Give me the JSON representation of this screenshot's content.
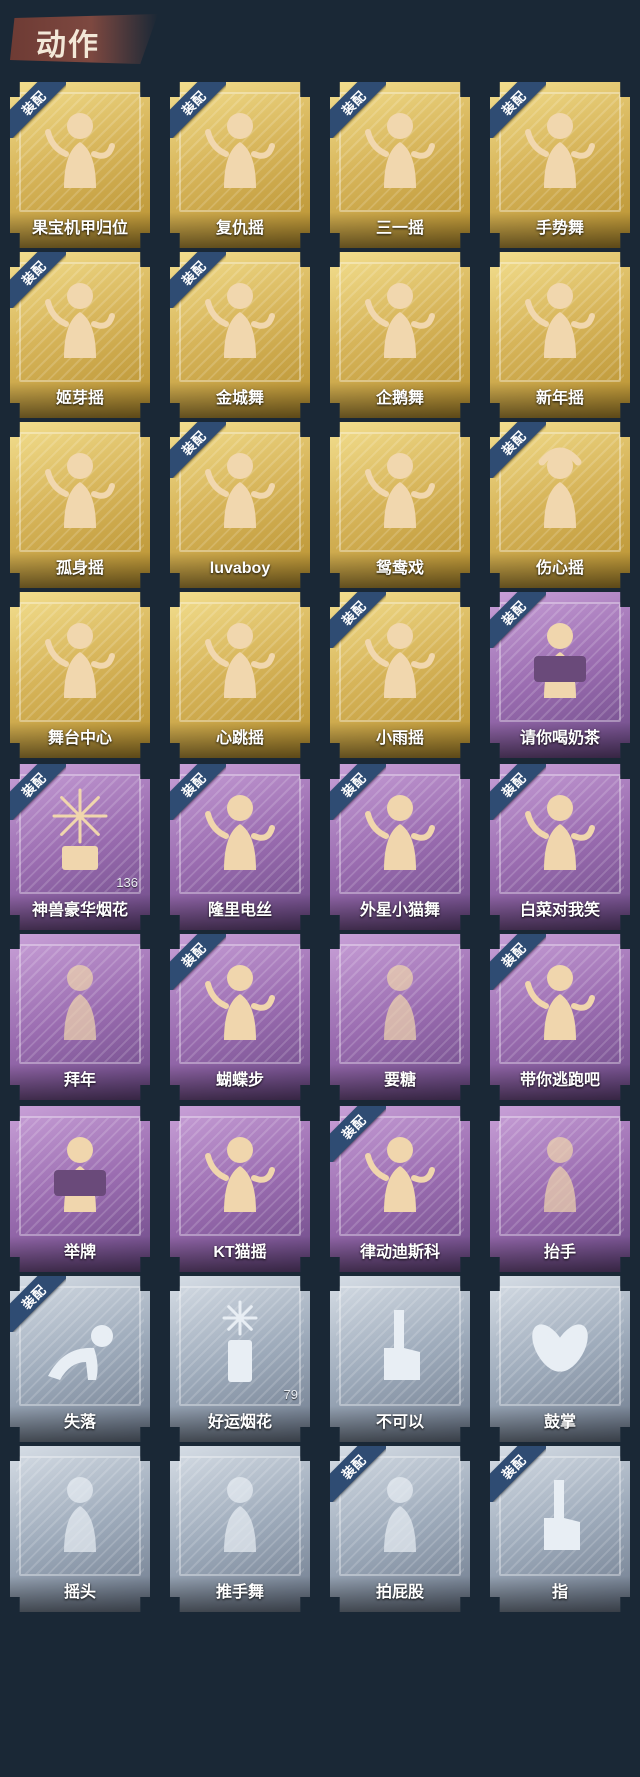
{
  "header": {
    "title": "动作"
  },
  "badge_text": "装配",
  "colors": {
    "gold": "#d7b55a",
    "purple": "#9a6cb0",
    "silver": "#9eabbb",
    "badge": "#2f4c73",
    "background": "#1a2836"
  },
  "emotes": [
    {
      "name": "果宝机甲归位",
      "rarity": "gold",
      "equipped": true,
      "icon": "dancer-figure-icon"
    },
    {
      "name": "复仇摇",
      "rarity": "gold",
      "equipped": true,
      "icon": "dancer-figure-icon"
    },
    {
      "name": "三一摇",
      "rarity": "gold",
      "equipped": true,
      "icon": "dancer-figure-icon"
    },
    {
      "name": "手势舞",
      "rarity": "gold",
      "equipped": true,
      "icon": "dancer-figure-icon"
    },
    {
      "name": "姬芽摇",
      "rarity": "gold",
      "equipped": true,
      "icon": "dancer-figure-icon"
    },
    {
      "name": "金城舞",
      "rarity": "gold",
      "equipped": true,
      "icon": "dancer-figure-icon"
    },
    {
      "name": "企鹅舞",
      "rarity": "gold",
      "equipped": false,
      "icon": "dancer-figure-icon"
    },
    {
      "name": "新年摇",
      "rarity": "gold",
      "equipped": false,
      "icon": "dancer-figure-icon"
    },
    {
      "name": "孤身摇",
      "rarity": "gold",
      "equipped": false,
      "icon": "dancer-figure-icon"
    },
    {
      "name": "luvaboy",
      "rarity": "gold",
      "equipped": true,
      "icon": "dancer-figure-icon"
    },
    {
      "name": "鸳鸯戏",
      "rarity": "gold",
      "equipped": false,
      "icon": "dancer-figure-icon"
    },
    {
      "name": "伤心摇",
      "rarity": "gold",
      "equipped": true,
      "icon": "heart-pose-icon"
    },
    {
      "name": "舞台中心",
      "rarity": "gold",
      "equipped": false,
      "icon": "dancer-figure-icon"
    },
    {
      "name": "心跳摇",
      "rarity": "gold",
      "equipped": false,
      "icon": "dancer-figure-icon"
    },
    {
      "name": "小雨摇",
      "rarity": "gold",
      "equipped": true,
      "icon": "dancer-figure-icon"
    },
    {
      "name": "请你喝奶茶",
      "rarity": "purple",
      "equipped": true,
      "icon": "figure-with-sign-icon"
    },
    {
      "name": "神兽豪华烟花",
      "rarity": "purple",
      "equipped": true,
      "icon": "fireworks-box-icon",
      "count": "136"
    },
    {
      "name": "隆里电丝",
      "rarity": "purple",
      "equipped": true,
      "icon": "dancer-figure-icon"
    },
    {
      "name": "外星小猫舞",
      "rarity": "purple",
      "equipped": true,
      "icon": "dancer-figure-icon"
    },
    {
      "name": "白菜对我笑",
      "rarity": "purple",
      "equipped": true,
      "icon": "dancer-figure-icon"
    },
    {
      "name": "拜年",
      "rarity": "purple",
      "equipped": false,
      "icon": "bowing-figure-icon"
    },
    {
      "name": "蝴蝶步",
      "rarity": "purple",
      "equipped": true,
      "icon": "dancer-figure-icon"
    },
    {
      "name": "要糖",
      "rarity": "purple",
      "equipped": false,
      "icon": "ghost-figure-icon"
    },
    {
      "name": "带你逃跑吧",
      "rarity": "purple",
      "equipped": true,
      "icon": "dancer-figure-icon"
    },
    {
      "name": "举牌",
      "rarity": "purple",
      "equipped": false,
      "icon": "figure-with-sign-icon"
    },
    {
      "name": "KT猫摇",
      "rarity": "purple",
      "equipped": false,
      "icon": "dancer-figure-icon"
    },
    {
      "name": "律动迪斯科",
      "rarity": "purple",
      "equipped": true,
      "icon": "dancer-figure-icon"
    },
    {
      "name": "抬手",
      "rarity": "purple",
      "equipped": false,
      "icon": "ghost-figure-icon"
    },
    {
      "name": "失落",
      "rarity": "silver",
      "equipped": true,
      "icon": "crawling-figure-icon"
    },
    {
      "name": "好运烟花",
      "rarity": "silver",
      "equipped": false,
      "icon": "firecracker-icon",
      "count": "79"
    },
    {
      "name": "不可以",
      "rarity": "silver",
      "equipped": false,
      "icon": "pointing-hand-icon"
    },
    {
      "name": "鼓掌",
      "rarity": "silver",
      "equipped": false,
      "icon": "clapping-hands-icon"
    },
    {
      "name": "摇头",
      "rarity": "silver",
      "equipped": false,
      "icon": "ghost-figure-icon"
    },
    {
      "name": "推手舞",
      "rarity": "silver",
      "equipped": false,
      "icon": "ghost-figure-icon"
    },
    {
      "name": "拍屁股",
      "rarity": "silver",
      "equipped": true,
      "icon": "ghost-figure-icon"
    },
    {
      "name": "指",
      "rarity": "silver",
      "equipped": true,
      "icon": "pointing-hand-icon"
    }
  ]
}
